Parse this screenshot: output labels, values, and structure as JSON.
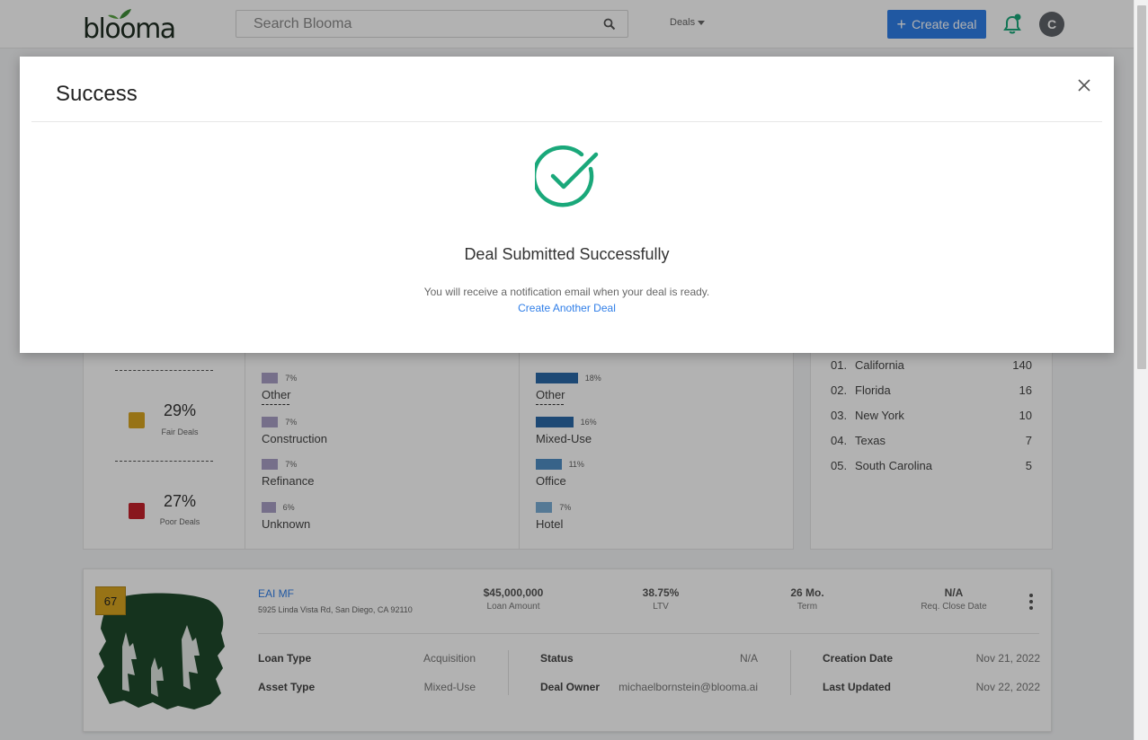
{
  "header": {
    "logo_text": "blooma",
    "search_placeholder": "Search Blooma",
    "deals_menu_label": "Deals",
    "create_deal_label": "Create deal",
    "avatar_initial": "C",
    "brand_color": "#2f7ee8",
    "bell_color": "#1aa87a"
  },
  "scores": [
    {
      "percent": "29%",
      "label": "Fair Deals",
      "color": "#d9a520"
    },
    {
      "percent": "27%",
      "label": "Poor Deals",
      "color": "#c4212c"
    }
  ],
  "loan_types": [
    {
      "label": "Other",
      "percent": "7%",
      "value": 7
    },
    {
      "label": "Construction",
      "percent": "7%",
      "value": 7
    },
    {
      "label": "Refinance",
      "percent": "7%",
      "value": 7
    },
    {
      "label": "Unknown",
      "percent": "6%",
      "value": 6
    }
  ],
  "asset_types": [
    {
      "label": "Other",
      "percent": "18%",
      "value": 18
    },
    {
      "label": "Mixed-Use",
      "percent": "16%",
      "value": 16
    },
    {
      "label": "Office",
      "percent": "11%",
      "value": 11
    },
    {
      "label": "Hotel",
      "percent": "7%",
      "value": 7
    }
  ],
  "states": [
    {
      "rank": "01.",
      "name": "California",
      "count": "140"
    },
    {
      "rank": "02.",
      "name": "Florida",
      "count": "16"
    },
    {
      "rank": "03.",
      "name": "New York",
      "count": "10"
    },
    {
      "rank": "04.",
      "name": "Texas",
      "count": "7"
    },
    {
      "rank": "05.",
      "name": "South Carolina",
      "count": "5"
    }
  ],
  "deal": {
    "score": "67",
    "name": "EAI MF",
    "address": "5925 Linda Vista Rd, San Diego, CA 92110",
    "metrics": [
      {
        "value": "$45,000,000",
        "label": "Loan Amount"
      },
      {
        "value": "38.75%",
        "label": "LTV"
      },
      {
        "value": "26 Mo.",
        "label": "Term"
      },
      {
        "value": "N/A",
        "label": "Req. Close Date"
      }
    ],
    "details": {
      "loan_type_label": "Loan Type",
      "loan_type_value": "Acquisition",
      "asset_type_label": "Asset Type",
      "asset_type_value": "Mixed-Use",
      "status_label": "Status",
      "status_value": "N/A",
      "owner_label": "Deal Owner",
      "owner_value": "michaelbornstein@blooma.ai",
      "creation_label": "Creation Date",
      "creation_value": "Nov 21, 2022",
      "updated_label": "Last Updated",
      "updated_value": "Nov 22, 2022"
    }
  },
  "modal": {
    "title": "Success",
    "heading": "Deal Submitted Successfully",
    "message": "You will receive a notification email when your deal is ready.",
    "link": "Create Another Deal",
    "check_color": "#1aa87a"
  }
}
